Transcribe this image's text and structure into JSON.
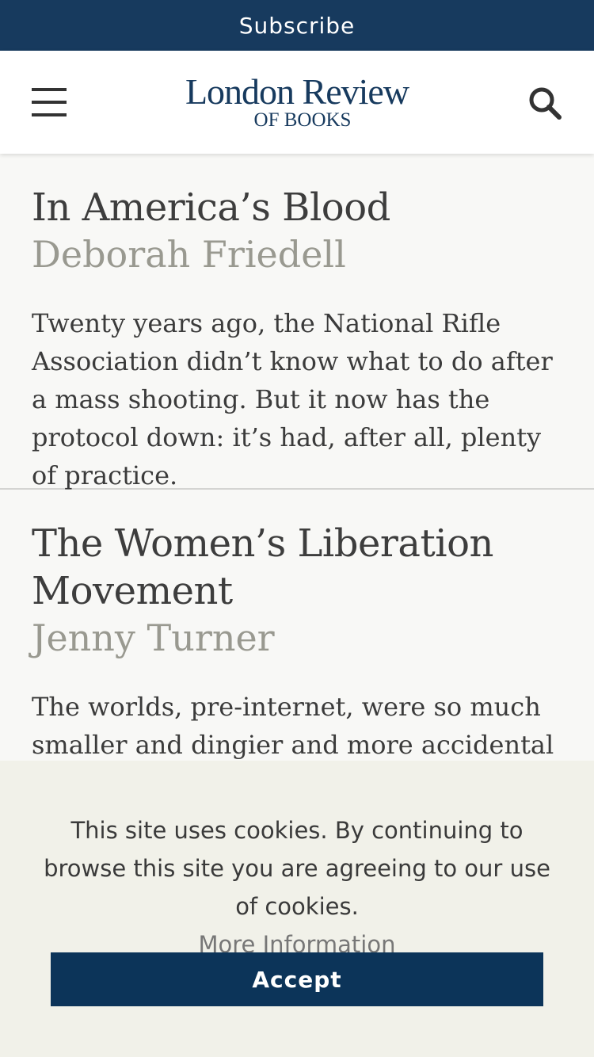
{
  "subscribe": {
    "label": "Subscribe"
  },
  "header": {
    "logo_line1": "London Review",
    "logo_line2": "OF BOOKS",
    "menu_icon": "hamburger-menu-icon",
    "search_icon": "search-icon"
  },
  "articles": [
    {
      "title": "In America’s Blood",
      "author": "Deborah Friedell",
      "excerpt": "Twenty years ago, the National Rifle Association didn’t know what to do after a mass shooting. But it now has the protocol down: it’s had, after all, plenty of practice."
    },
    {
      "title": "The Women’s Liberation Movement",
      "author": "Jenny Turner",
      "excerpt": "The worlds, pre-internet, were so much smaller and dingier and more accidental"
    }
  ],
  "cookie_banner": {
    "text": "This site uses cookies. By continuing to browse this site you are agreeing to our use of cookies.",
    "link_label": "More Information",
    "accept_label": "Accept"
  },
  "colors": {
    "brand_navy": "#173a5e",
    "accept_button": "#0c3459",
    "author_gray": "#999990",
    "banner_bg": "#f1f1e9"
  }
}
